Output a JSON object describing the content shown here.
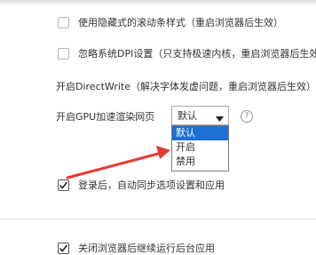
{
  "settings": {
    "hidden_scrollbar": {
      "label": "使用隐藏式的滚动条样式（重启浏览器后生效）",
      "checked": false
    },
    "ignore_dpi": {
      "label": "忽略系统DPI设置（只支持极速内核，重启浏览器后生效）",
      "checked": false
    },
    "directwrite": {
      "label": "开启DirectWrite（解决字体发虚问题，重启浏览器后生效）"
    },
    "gpu": {
      "label": "开启GPU加速渲染网页",
      "selected": "默认",
      "options": [
        "默认",
        "开启",
        "禁用"
      ],
      "help_symbol": "?"
    },
    "sync": {
      "label": "登录后，自动同步选项设置和应用",
      "checked": true
    },
    "background_run": {
      "label": "关闭浏览器后继续运行后台应用",
      "checked": true
    }
  },
  "colors": {
    "highlight": "#1e6fd6",
    "annotation_arrow": "#e53935"
  },
  "icons": {
    "dropdown_arrow": "triangle-down",
    "checkmark": "check",
    "help": "circle-question"
  }
}
